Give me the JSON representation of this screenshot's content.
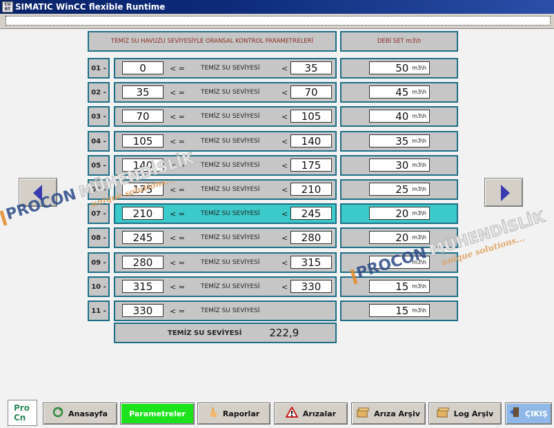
{
  "window": {
    "title": "SIMATIC WinCC flexible Runtime",
    "icon_text": "CU RT"
  },
  "header": {
    "param_title": "TEMİZ SU HAVUZU SEVİYESİYLE ORANSAL KONTROL PARAMETRELERİ",
    "flow_title": "DEBİ SET m3\\h"
  },
  "symbols": {
    "le": "< =",
    "lt": "<",
    "level_label": "TEMİZ SU SEVİYESİ",
    "unit": "m3\\h"
  },
  "rows": [
    {
      "num": "01 -",
      "low": "0",
      "high": "35",
      "flow": "50"
    },
    {
      "num": "02 -",
      "low": "35",
      "high": "70",
      "flow": "45"
    },
    {
      "num": "03 -",
      "low": "70",
      "high": "105",
      "flow": "40"
    },
    {
      "num": "04 -",
      "low": "105",
      "high": "140",
      "flow": "35"
    },
    {
      "num": "05 -",
      "low": "140",
      "high": "175",
      "flow": "30"
    },
    {
      "num": "06 -",
      "low": "175",
      "high": "210",
      "flow": "25"
    },
    {
      "num": "07 -",
      "low": "210",
      "high": "245",
      "flow": "20",
      "active": true
    },
    {
      "num": "08 -",
      "low": "245",
      "high": "280",
      "flow": "20"
    },
    {
      "num": "09 -",
      "low": "280",
      "high": "315",
      "flow": ""
    },
    {
      "num": "10 -",
      "low": "315",
      "high": "330",
      "flow": "15"
    },
    {
      "num": "11 -",
      "low": "330",
      "high": "",
      "flow": "15"
    }
  ],
  "current_level": {
    "label": "TEMİZ SU SEVİYESİ",
    "value": "222,9"
  },
  "watermark": {
    "brand": "PROCON",
    "word": "MÜHENDİSLİK",
    "tagline": "unique solutions..."
  },
  "nav": {
    "prev_icon": "arrow-left-icon",
    "next_icon": "arrow-right-icon"
  },
  "taskbar": {
    "logo_text": "Pro Cn",
    "buttons": [
      {
        "label": "Anasayfa",
        "icon": "refresh-icon"
      },
      {
        "label": "Parametreler",
        "icon": "",
        "active": true
      },
      {
        "label": "Raporlar",
        "icon": "hand-pointer-icon"
      },
      {
        "label": "Arızalar",
        "icon": "warning-icon"
      },
      {
        "label": "Arıza Arşiv",
        "icon": "archive-box-icon"
      },
      {
        "label": "Log Arşiv",
        "icon": "archive-box-icon"
      },
      {
        "label": "ÇIKIŞ",
        "icon": "exit-door-icon"
      }
    ]
  },
  "colors": {
    "active_row": "#3bc9c9",
    "active_button": "#1ce31c",
    "frame": "#1d6f86",
    "header_text": "#8b2b1f"
  }
}
